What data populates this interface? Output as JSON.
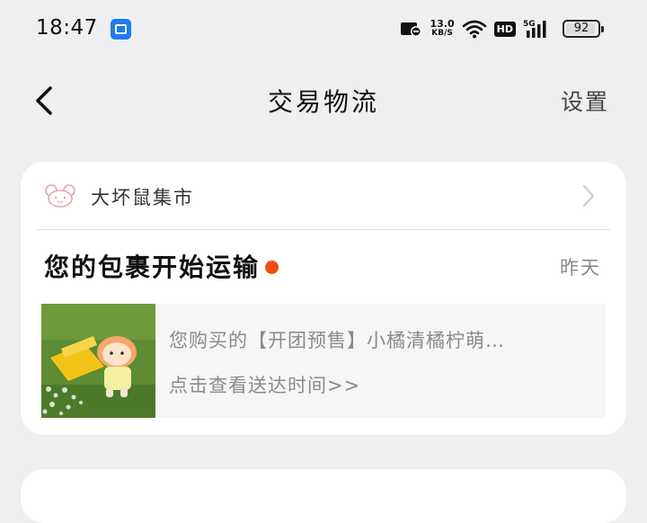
{
  "status_bar": {
    "time": "18:47",
    "net_speed_value": "13.0",
    "net_speed_unit": "KB/S",
    "hd_label": "HD",
    "network_type": "5G",
    "battery_level": "92",
    "icons": [
      "app-notification-icon",
      "nfc-icon",
      "wifi-icon",
      "hd-icon",
      "signal-5g-icon",
      "battery-icon"
    ]
  },
  "nav": {
    "title": "交易物流",
    "right_action": "设置"
  },
  "card": {
    "shop_name": "大坏鼠集市",
    "headline": "您的包裹开始运输",
    "date": "昨天",
    "item_title": "您购买的【开团预售】小橘清橘柠萌…",
    "item_link": "点击查看送达时间>>"
  },
  "colors": {
    "page_bg": "#efeff1",
    "card_bg": "#ffffff",
    "accent_dot": "#f04d10",
    "app_badge": "#1e7bf2"
  }
}
